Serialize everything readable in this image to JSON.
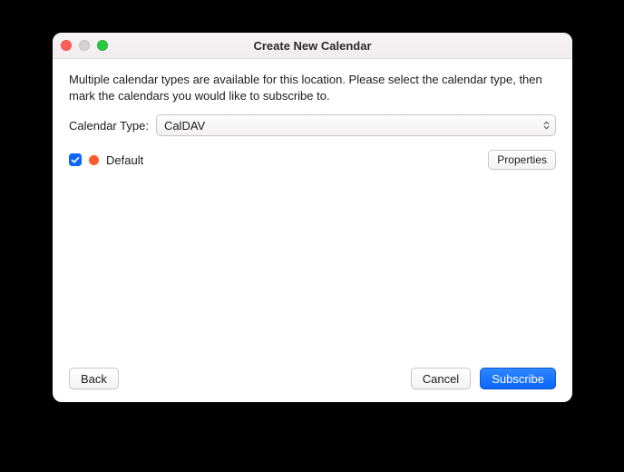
{
  "window": {
    "title": "Create New Calendar"
  },
  "instructions": "Multiple calendar types are available for this location. Please select the calendar type, then mark the calendars you would like to subscribe to.",
  "calendarType": {
    "label": "Calendar Type:",
    "value": "CalDAV"
  },
  "calendars": [
    {
      "name": "Default",
      "checked": true,
      "colorHex": "#ff5a2b"
    }
  ],
  "buttons": {
    "properties": "Properties",
    "back": "Back",
    "cancel": "Cancel",
    "subscribe": "Subscribe"
  }
}
